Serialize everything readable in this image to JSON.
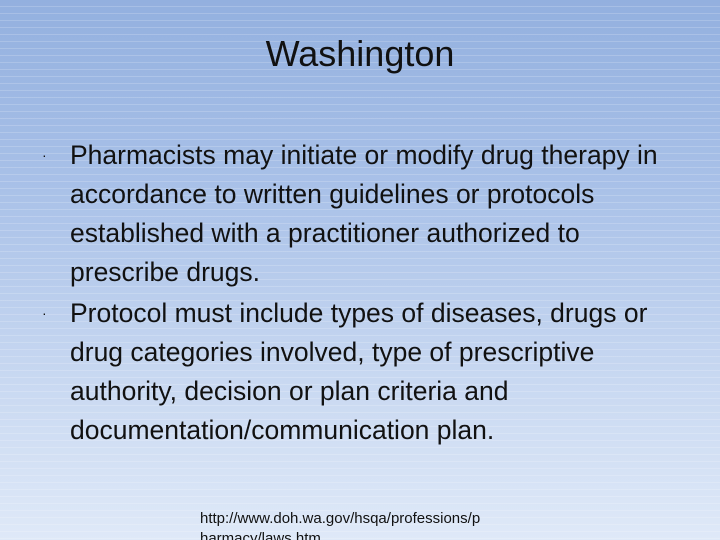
{
  "slide": {
    "title": "Washington",
    "bullets": [
      "Pharmacists may initiate or modify drug therapy in accordance to written guidelines or protocols established with a practitioner authorized to prescribe drugs.",
      "Protocol must include types of diseases, drugs or drug categories involved, type of prescriptive authority, decision or plan criteria and documentation/communication plan."
    ],
    "bullet_glyph": "·",
    "source_url_line1": "http://www.doh.wa.gov/hsqa/professions/p",
    "source_url_line2": "harmacy/laws.htm"
  }
}
